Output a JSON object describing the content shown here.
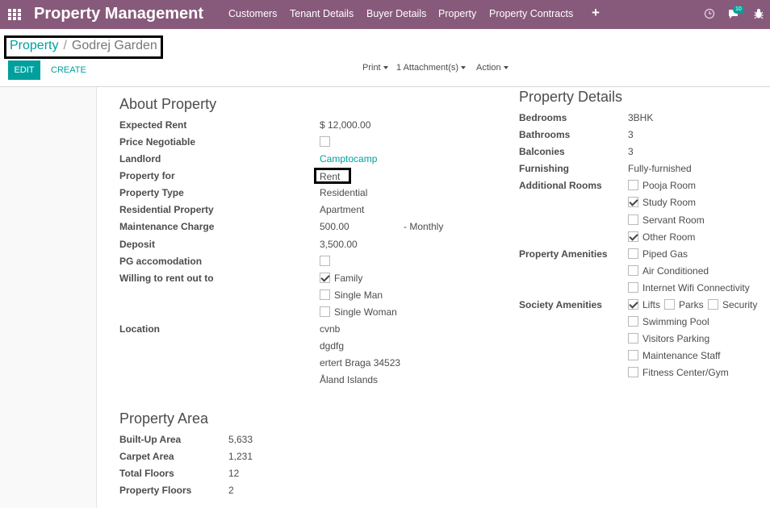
{
  "navbar": {
    "brand": "Property Management",
    "menus": [
      "Customers",
      "Tenant Details",
      "Buyer Details",
      "Property",
      "Property Contracts"
    ],
    "add_label": "+",
    "messages_badge": "10",
    "color": "#875a7b"
  },
  "breadcrumb": {
    "parent": "Property",
    "separator": "/",
    "current": "Godrej Garden"
  },
  "toolbar": {
    "edit": "EDIT",
    "create": "CREATE",
    "print": "Print",
    "attachments": "1 Attachment(s)",
    "action": "Action"
  },
  "about": {
    "title": "About Property",
    "expected_rent_label": "Expected Rent",
    "expected_rent": "$ 12,000.00",
    "price_negotiable_label": "Price Negotiable",
    "price_negotiable": false,
    "landlord_label": "Landlord",
    "landlord": "Camptocamp",
    "property_for_label": "Property for",
    "property_for": "Rent",
    "property_type_label": "Property Type",
    "property_type": "Residential",
    "residential_property_label": "Residential Property",
    "residential_property": "Apartment",
    "maintenance_label": "Maintenance Charge",
    "maintenance": "500.00",
    "maintenance_period": "- Monthly",
    "deposit_label": "Deposit",
    "deposit": "3,500.00",
    "pg_label": "PG accomodation",
    "pg": false,
    "willing_label": "Willing to rent out to",
    "willing": [
      {
        "label": "Family",
        "checked": true
      },
      {
        "label": "Single Man",
        "checked": false
      },
      {
        "label": "Single Woman",
        "checked": false
      }
    ],
    "location_label": "Location",
    "location": [
      "cvnb",
      "dgdfg",
      "ertert Braga 34523",
      "Åland Islands"
    ]
  },
  "details": {
    "title": "Property Details",
    "bedrooms_label": "Bedrooms",
    "bedrooms": "3BHK",
    "bathrooms_label": "Bathrooms",
    "bathrooms": "3",
    "balconies_label": "Balconies",
    "balconies": "3",
    "furnishing_label": "Furnishing",
    "furnishing": "Fully-furnished",
    "additional_label": "Additional Rooms",
    "additional": [
      {
        "label": "Pooja Room",
        "checked": false
      },
      {
        "label": "Study Room",
        "checked": true
      },
      {
        "label": "Servant Room",
        "checked": false
      },
      {
        "label": "Other Room",
        "checked": true
      }
    ],
    "amenities_label": "Property Amenities",
    "amenities": [
      {
        "label": "Piped Gas",
        "checked": false
      },
      {
        "label": "Air Conditioned",
        "checked": false
      },
      {
        "label": "Internet Wifi Connectivity",
        "checked": false
      }
    ],
    "society_label": "Society Amenities",
    "society_row": [
      {
        "label": "Lifts",
        "checked": true
      },
      {
        "label": "Parks",
        "checked": false
      },
      {
        "label": "Security",
        "checked": false
      }
    ],
    "society": [
      {
        "label": "Swimming Pool",
        "checked": false
      },
      {
        "label": "Visitors Parking",
        "checked": false
      },
      {
        "label": "Maintenance Staff",
        "checked": false
      },
      {
        "label": "Fitness Center/Gym",
        "checked": false
      }
    ]
  },
  "area": {
    "title": "Property Area",
    "built_up_label": "Built-Up Area",
    "built_up": "5,633",
    "carpet_label": "Carpet Area",
    "carpet": "1,231",
    "total_floors_label": "Total Floors",
    "total_floors": "12",
    "property_floors_label": "Property Floors",
    "property_floors": "2"
  }
}
